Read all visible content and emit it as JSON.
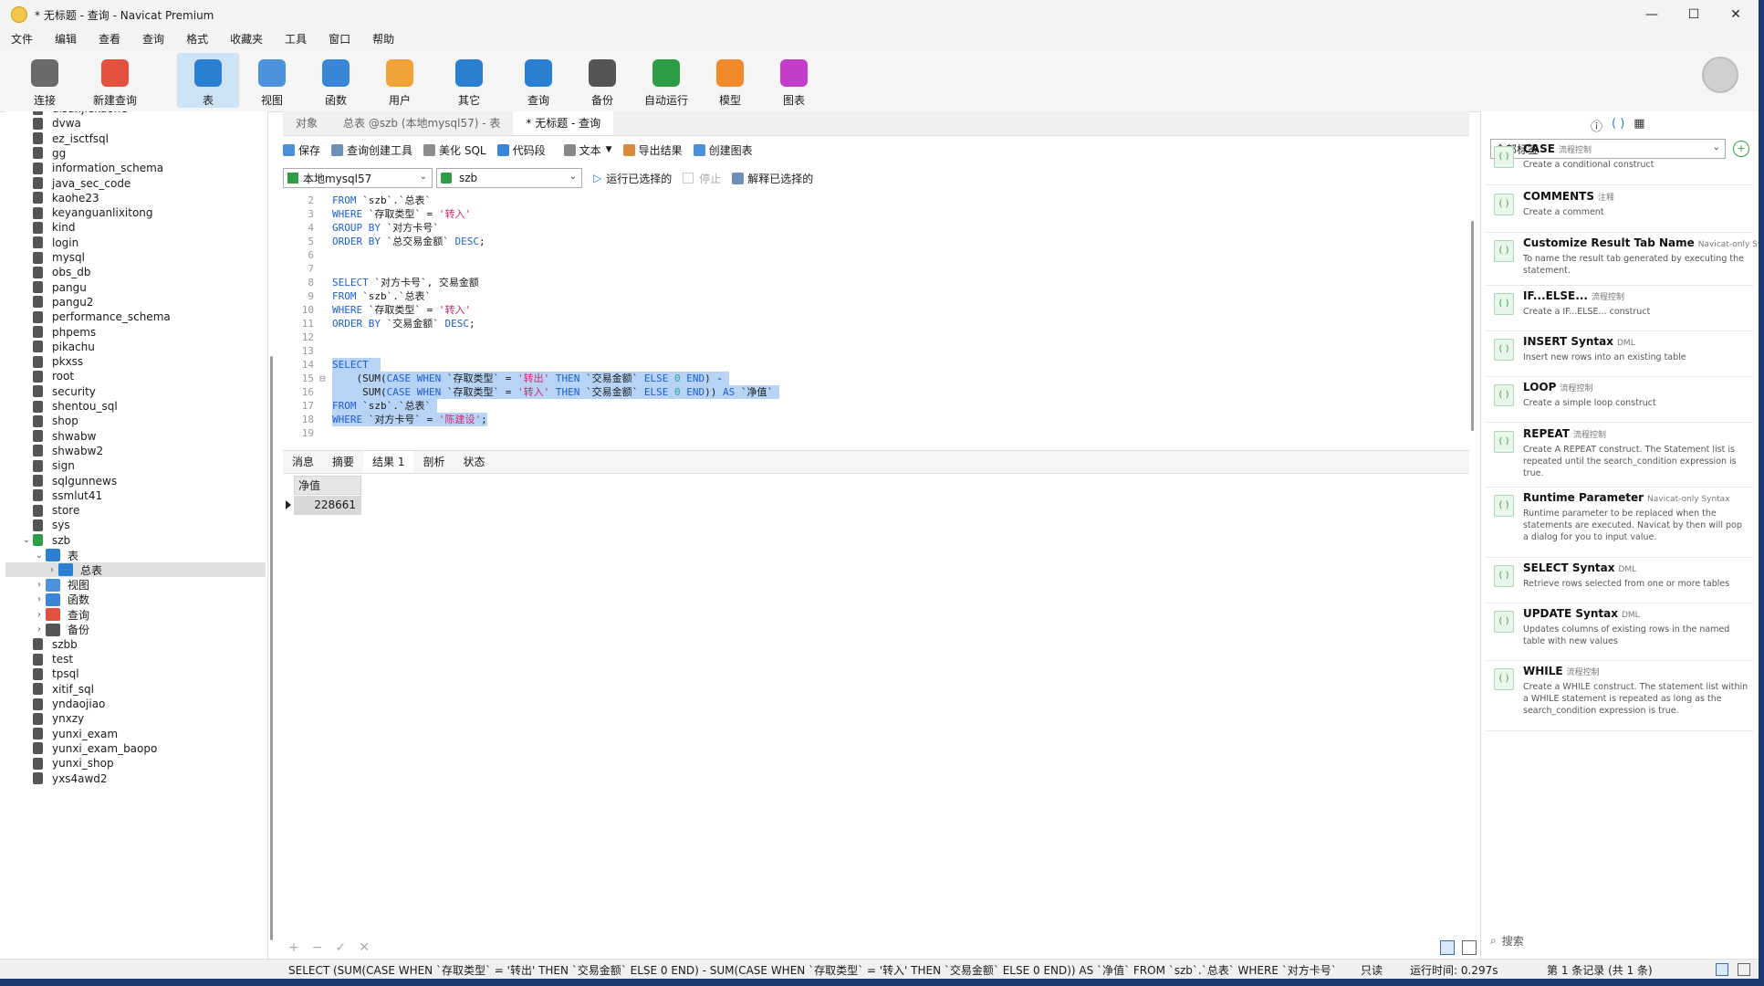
{
  "window": {
    "title": "* 无标题 - 查询 - Navicat Premium",
    "controls": [
      "—",
      "☐",
      "✕"
    ]
  },
  "menu": [
    "文件",
    "编辑",
    "查看",
    "查询",
    "格式",
    "收藏夹",
    "工具",
    "窗口",
    "帮助"
  ],
  "toolbar": [
    {
      "label": "连接",
      "icon": "plug-icon",
      "color": "#6a6a6a"
    },
    {
      "label": "新建查询",
      "icon": "new-query-icon",
      "color": "#e2513d"
    },
    {
      "label": "表",
      "icon": "table-icon",
      "color": "#2b7fd3"
    },
    {
      "label": "视图",
      "icon": "view-icon",
      "color": "#2b7fd3"
    },
    {
      "label": "函数",
      "icon": "function-icon",
      "color": "#2b7fd3"
    },
    {
      "label": "用户",
      "icon": "user-icon",
      "color": "#f0a23b"
    },
    {
      "label": "其它",
      "icon": "tools-icon",
      "color": "#2b7fd3"
    },
    {
      "label": "查询",
      "icon": "query-icon",
      "color": "#2b7fd3"
    },
    {
      "label": "备份",
      "icon": "backup-icon",
      "color": "#555555"
    },
    {
      "label": "自动运行",
      "icon": "robot-icon",
      "color": "#2e9e45"
    },
    {
      "label": "模型",
      "icon": "model-icon",
      "color": "#f08a2b"
    },
    {
      "label": "图表",
      "icon": "chart-icon",
      "color": "#c23ec8"
    }
  ],
  "navigator": {
    "items": [
      {
        "label": "disanjiekaohe",
        "type": "db"
      },
      {
        "label": "dvwa",
        "type": "db"
      },
      {
        "label": "ez_isctfsql",
        "type": "db"
      },
      {
        "label": "gg",
        "type": "db"
      },
      {
        "label": "information_schema",
        "type": "db"
      },
      {
        "label": "java_sec_code",
        "type": "db"
      },
      {
        "label": "kaohe23",
        "type": "db"
      },
      {
        "label": "keyanguanlixitong",
        "type": "db"
      },
      {
        "label": "kind",
        "type": "db"
      },
      {
        "label": "login",
        "type": "db"
      },
      {
        "label": "mysql",
        "type": "db"
      },
      {
        "label": "obs_db",
        "type": "db"
      },
      {
        "label": "pangu",
        "type": "db"
      },
      {
        "label": "pangu2",
        "type": "db"
      },
      {
        "label": "performance_schema",
        "type": "db"
      },
      {
        "label": "phpems",
        "type": "db"
      },
      {
        "label": "pikachu",
        "type": "db"
      },
      {
        "label": "pkxss",
        "type": "db"
      },
      {
        "label": "root",
        "type": "db"
      },
      {
        "label": "security",
        "type": "db"
      },
      {
        "label": "shentou_sql",
        "type": "db"
      },
      {
        "label": "shop",
        "type": "db"
      },
      {
        "label": "shwabw",
        "type": "db"
      },
      {
        "label": "shwabw2",
        "type": "db"
      },
      {
        "label": "sign",
        "type": "db"
      },
      {
        "label": "sqlgunnews",
        "type": "db"
      },
      {
        "label": "ssmlut41",
        "type": "db"
      },
      {
        "label": "store",
        "type": "db"
      },
      {
        "label": "sys",
        "type": "db"
      },
      {
        "label": "szb",
        "type": "db-open"
      },
      {
        "label": "表",
        "type": "folder-table"
      },
      {
        "label": "总表",
        "type": "table"
      },
      {
        "label": "视图",
        "type": "folder-view"
      },
      {
        "label": "函数",
        "type": "folder-func"
      },
      {
        "label": "查询",
        "type": "folder-query"
      },
      {
        "label": "备份",
        "type": "folder-backup"
      },
      {
        "label": "szbb",
        "type": "db"
      },
      {
        "label": "test",
        "type": "db"
      },
      {
        "label": "tpsql",
        "type": "db"
      },
      {
        "label": "xitif_sql",
        "type": "db"
      },
      {
        "label": "yndaojiao",
        "type": "db"
      },
      {
        "label": "ynxzy",
        "type": "db"
      },
      {
        "label": "yunxi_exam",
        "type": "db"
      },
      {
        "label": "yunxi_exam_baopo",
        "type": "db"
      },
      {
        "label": "yunxi_shop",
        "type": "db"
      },
      {
        "label": "yxs4awd2",
        "type": "db"
      }
    ]
  },
  "tabs": {
    "objects": "对象",
    "table_tab": "总表 @szb (本地mysql57) - 表",
    "query_tab": "* 无标题 - 查询"
  },
  "query_toolbar": {
    "save": "保存",
    "builder": "查询创建工具",
    "beautify": "美化 SQL",
    "snippet": "代码段",
    "text": "文本",
    "export": "导出结果",
    "create_chart": "创建图表"
  },
  "query_bar": {
    "connection": "本地mysql57",
    "database": "szb",
    "run_selected": "运行已选择的",
    "stop": "停止",
    "explain": "解释已选择的"
  },
  "result_tabs": [
    "消息",
    "摘要",
    "结果 1",
    "剖析",
    "状态"
  ],
  "result": {
    "column": "净值",
    "value": "228661"
  },
  "statusbar": {
    "sql": "SELECT      (SUM(CASE WHEN `存取类型` = '转出' THEN `交易金额` ELSE 0 END) -       SUM(CASE WHEN `存取类型` = '转入' THEN `交易金额` ELSE 0 END)) AS `净值` FROM `szb`.`总表` WHERE `对方卡号`",
    "readonly": "只读",
    "runtime": "运行时间: 0.297s",
    "records": "第 1 条记录 (共 1 条)"
  },
  "right_panel": {
    "filter": "全部标签",
    "search": "搜索",
    "snippets": [
      {
        "title": "CASE",
        "tag": "流程控制",
        "desc": "Create a conditional construct"
      },
      {
        "title": "COMMENTS",
        "tag": "注释",
        "desc": "Create a comment"
      },
      {
        "title": "Customize Result Tab Name",
        "tag": "Navicat-only Syn",
        "desc": "To name the result tab generated by executing the statement."
      },
      {
        "title": "IF...ELSE...",
        "tag": "流程控制",
        "desc": "Create a IF...ELSE... construct"
      },
      {
        "title": "INSERT Syntax",
        "tag": "DML",
        "desc": "Insert new rows into an existing table"
      },
      {
        "title": "LOOP",
        "tag": "流程控制",
        "desc": "Create a simple loop construct"
      },
      {
        "title": "REPEAT",
        "tag": "流程控制",
        "desc": "Create A REPEAT construct. The Statement list is repeated until the search_condition expression is true."
      },
      {
        "title": "Runtime Parameter",
        "tag": "Navicat-only Syntax",
        "desc": "Runtime parameter to be replaced when the statements are executed. Navicat by then will pop a dialog for you to input value."
      },
      {
        "title": "SELECT Syntax",
        "tag": "DML",
        "desc": "Retrieve rows selected from one or more tables"
      },
      {
        "title": "UPDATE Syntax",
        "tag": "DML",
        "desc": "Updates columns of existing rows in the named table with new values"
      },
      {
        "title": "WHILE",
        "tag": "流程控制",
        "desc": "Create a WHILE construct. The statement list within a WHILE statement is repeated as long as the search_condition expression is true."
      }
    ]
  }
}
